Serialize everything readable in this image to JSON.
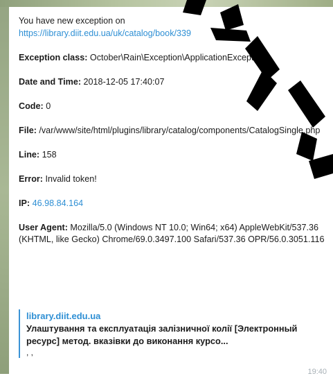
{
  "message": {
    "intro": "You have new exception on",
    "url": "https://library.diit.edu.ua/uk/catalog/book/339",
    "exception_class_label": "Exception class:",
    "exception_class_value": "October\\Rain\\Exception\\ApplicationException",
    "datetime_label": "Date and Time:",
    "datetime_value": "2018-12-05 17:40:07",
    "code_label": "Code:",
    "code_value": "0",
    "file_label": "File:",
    "file_value": "/var/www/site/html/plugins/library/catalog/components/CatalogSingle.php",
    "line_label": "Line:",
    "line_value": "158",
    "error_label": "Error:",
    "error_value": "Invalid token!",
    "ip_label": "IP:",
    "ip_value": "46.98.84.164",
    "user_agent_label": "User Agent:",
    "user_agent_value": "Mozilla/5.0 (Windows NT 10.0; Win64; x64) AppleWebKit/537.36 (KHTML, like Gecko) Chrome/69.0.3497.100 Safari/537.36 OPR/56.0.3051.116"
  },
  "link_preview": {
    "site": "library.diit.edu.ua",
    "title": "Улаштування та експлуатація залізничної колії [Электронный ресурс] метод. вказівки до виконання курсо...",
    "description": ", ,"
  },
  "time": "19:40",
  "colors": {
    "link": "#2e8fd4",
    "preview_bar": "#3a93d6",
    "time": "#a7b0b6",
    "watermark": "#000000",
    "background_wallpaper": "#a9b895"
  }
}
